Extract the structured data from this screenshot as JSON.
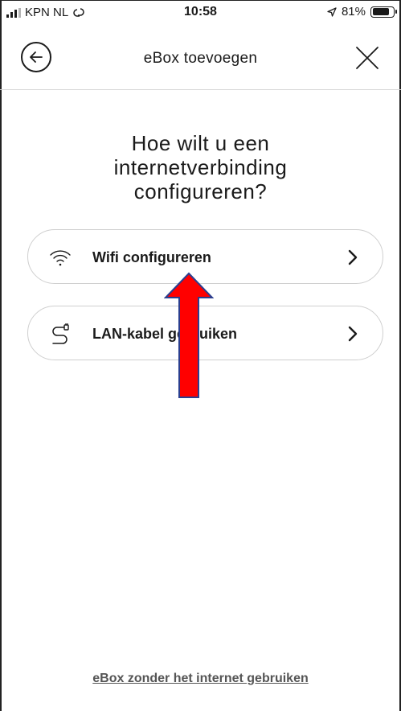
{
  "status_bar": {
    "carrier": "KPN NL",
    "time": "10:58",
    "battery_percent": "81%",
    "battery_level": 0.81,
    "icons": [
      "signal-icon",
      "link-icon",
      "location-arrow-icon",
      "battery-icon"
    ]
  },
  "header": {
    "title": "eBox toevoegen",
    "back_icon": "back-arrow-icon",
    "close_icon": "close-icon"
  },
  "main": {
    "question": "Hoe wilt u een internetverbinding configureren?",
    "options": [
      {
        "label": "Wifi configureren",
        "icon": "wifi-icon",
        "chevron": ">"
      },
      {
        "label": "LAN-kabel gebruiken",
        "icon": "cable-icon",
        "chevron": ">"
      }
    ]
  },
  "footer": {
    "link": "eBox zonder het internet gebruiken"
  },
  "annotation": {
    "arrow_color": "#ff0000",
    "arrow_outline_color": "#2b3f8f"
  }
}
